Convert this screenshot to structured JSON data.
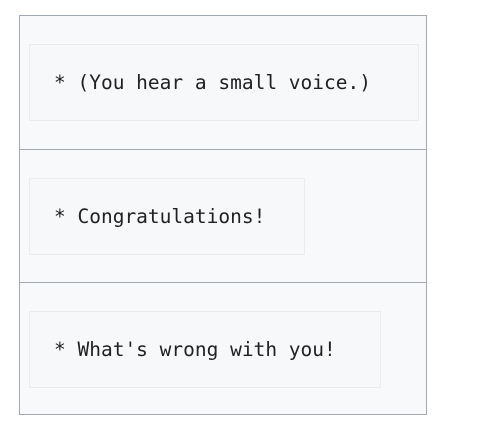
{
  "dialogue": {
    "lines": [
      "* (You hear a small voice.)",
      "* Congratulations!",
      "* What's wrong with you!"
    ]
  }
}
